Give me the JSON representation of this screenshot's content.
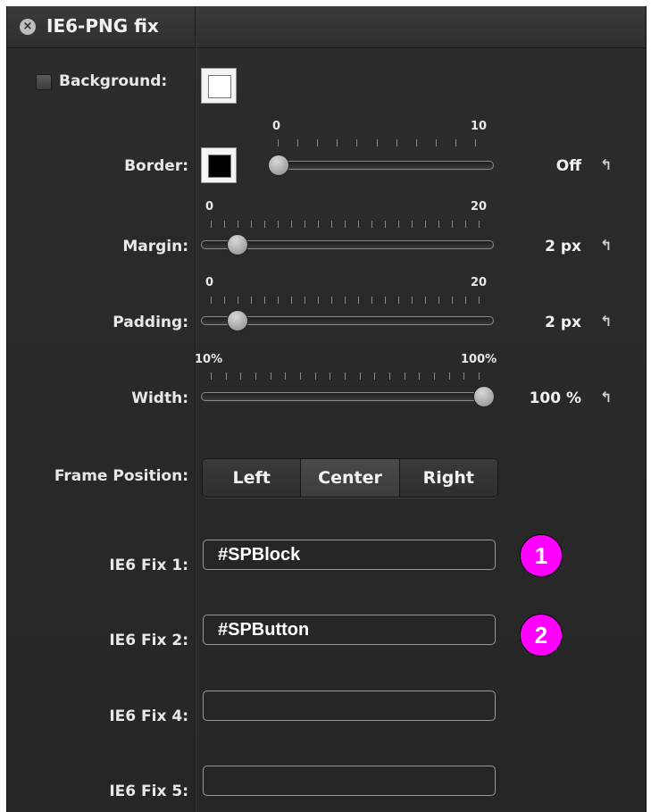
{
  "panel": {
    "title": "IE6-PNG fix",
    "close_icon": "close-icon"
  },
  "background": {
    "label": "Background:",
    "checked": false,
    "color": "#ffffff"
  },
  "border": {
    "label": "Border:",
    "color": "#000000",
    "min": "0",
    "max": "10",
    "value": "Off",
    "level": 0
  },
  "margin": {
    "label": "Margin:",
    "min": "0",
    "max": "20",
    "value": "2 px",
    "level": 0.1
  },
  "padding": {
    "label": "Padding:",
    "min": "0",
    "max": "20",
    "value": "2 px",
    "level": 0.1
  },
  "width": {
    "label": "Width:",
    "min": "10%",
    "max": "100%",
    "value": "100 %",
    "level": 1
  },
  "frame_position": {
    "label": "Frame Position:",
    "options": [
      "Left",
      "Center",
      "Right"
    ],
    "selected": "Center"
  },
  "fixes": [
    {
      "label": "IE6 Fix 1:",
      "value": "#SPBlock",
      "badge": "1"
    },
    {
      "label": "IE6 Fix 2:",
      "value": "#SPButton",
      "badge": "2"
    },
    {
      "label": "IE6 Fix 4:",
      "value": ""
    },
    {
      "label": "IE6 Fix 5:",
      "value": ""
    }
  ],
  "badge_color": "#ff00ff"
}
